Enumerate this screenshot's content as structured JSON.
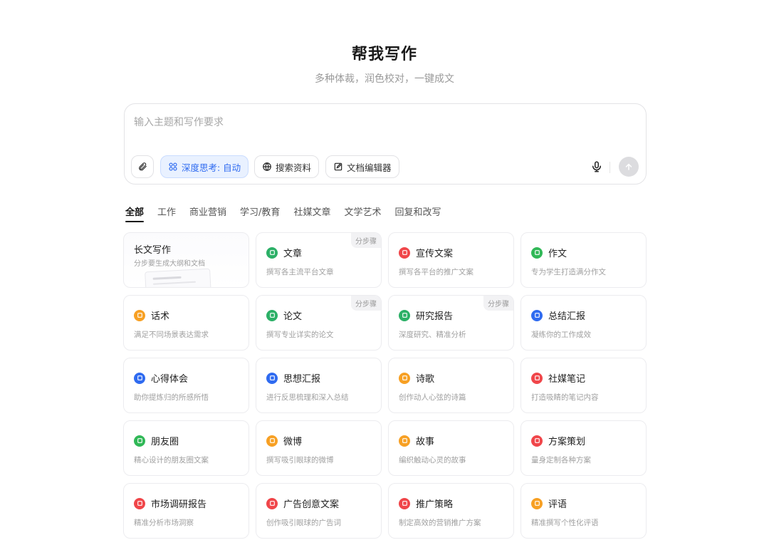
{
  "header": {
    "title": "帮我写作",
    "subtitle": "多种体裁，润色校对，一键成文"
  },
  "composer": {
    "placeholder": "输入主题和写作要求",
    "deep_think_label": "深度思考: 自动",
    "search_label": "搜索资料",
    "editor_label": "文档编辑器"
  },
  "tabs": [
    "全部",
    "工作",
    "商业营销",
    "学习/教育",
    "社媒文章",
    "文学艺术",
    "回复和改写"
  ],
  "cards": [
    {
      "name": "长文写作",
      "desc": "分步要生成大纲和文档",
      "color": "",
      "badge": ""
    },
    {
      "name": "文章",
      "desc": "撰写各主流平台文章",
      "color": "#2cb067",
      "badge": "分步骤"
    },
    {
      "name": "宣传文案",
      "desc": "撰写各平台的推广文案",
      "color": "#f0464a",
      "badge": ""
    },
    {
      "name": "作文",
      "desc": "专为学生打造满分作文",
      "color": "#31b857",
      "badge": ""
    },
    {
      "name": "话术",
      "desc": "满足不同场景表达需求",
      "color": "#f7a024",
      "badge": ""
    },
    {
      "name": "论文",
      "desc": "撰写专业详实的论文",
      "color": "#2cb067",
      "badge": "分步骤"
    },
    {
      "name": "研究报告",
      "desc": "深度研究、精准分析",
      "color": "#2cb067",
      "badge": "分步骤"
    },
    {
      "name": "总结汇报",
      "desc": "凝练你的工作成效",
      "color": "#2f6bf0",
      "badge": ""
    },
    {
      "name": "心得体会",
      "desc": "助你提炼归的所感所悟",
      "color": "#2f6bf0",
      "badge": ""
    },
    {
      "name": "思想汇报",
      "desc": "进行反思梳理和深入总结",
      "color": "#2f6bf0",
      "badge": ""
    },
    {
      "name": "诗歌",
      "desc": "创作动人心弦的诗篇",
      "color": "#f7a024",
      "badge": ""
    },
    {
      "name": "社媒笔记",
      "desc": "打造吸睛的笔记内容",
      "color": "#f0464a",
      "badge": ""
    },
    {
      "name": "朋友圈",
      "desc": "精心设计的朋友圈文案",
      "color": "#31b857",
      "badge": ""
    },
    {
      "name": "微博",
      "desc": "撰写吸引眼球的微博",
      "color": "#f7a024",
      "badge": ""
    },
    {
      "name": "故事",
      "desc": "编织触动心灵的故事",
      "color": "#f7a024",
      "badge": ""
    },
    {
      "name": "方案策划",
      "desc": "量身定制各种方案",
      "color": "#f0464a",
      "badge": ""
    },
    {
      "name": "市场调研报告",
      "desc": "精准分析市场洞察",
      "color": "#f0464a",
      "badge": ""
    },
    {
      "name": "广告创意文案",
      "desc": "创作吸引眼球的广告词",
      "color": "#f0464a",
      "badge": ""
    },
    {
      "name": "推广策略",
      "desc": "制定高效的营销推广方案",
      "color": "#f0464a",
      "badge": ""
    },
    {
      "name": "评语",
      "desc": "精准撰写个性化评语",
      "color": "#f7a024",
      "badge": ""
    }
  ]
}
